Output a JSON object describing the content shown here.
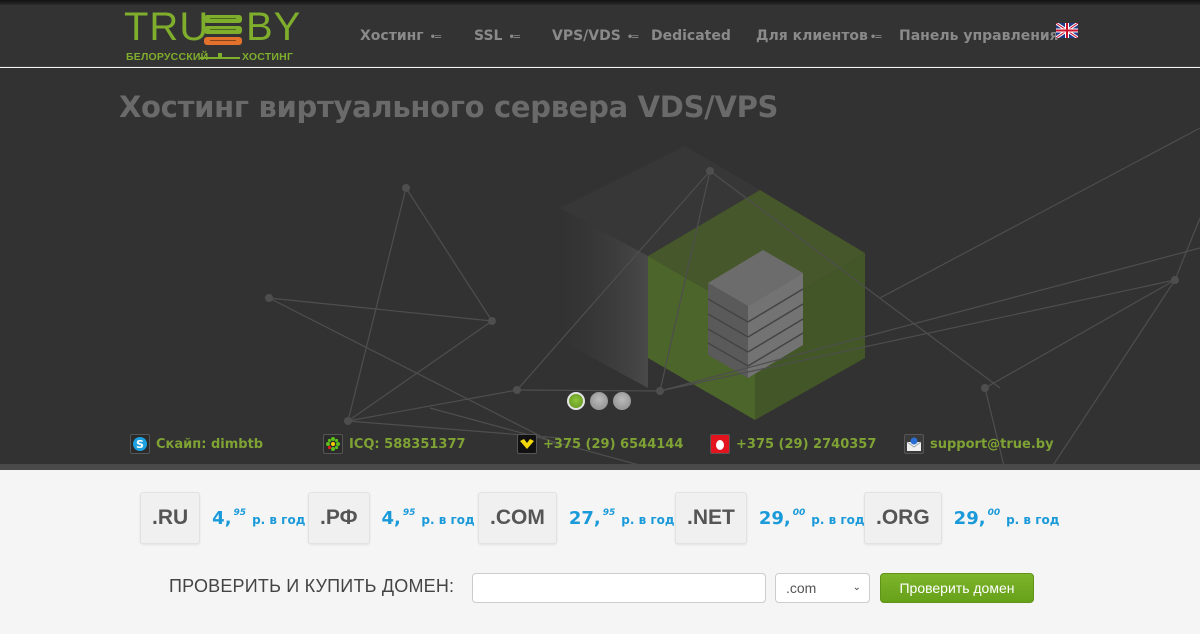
{
  "logo": {
    "left": "TRU",
    "right": "BY",
    "tagline_left": "БЕЛОРУССКИЙ",
    "tagline_right": "ХОСТИНГ",
    "colors": {
      "green": "#7fad2c",
      "orange": "#e2712b"
    }
  },
  "nav": {
    "items": [
      {
        "label": "Хостинг",
        "dropdown": true
      },
      {
        "label": "SSL",
        "dropdown": true
      },
      {
        "label": "VPS/VDS",
        "dropdown": true
      },
      {
        "label": "Dedicated",
        "dropdown": false
      },
      {
        "label": "Для клиентов",
        "dropdown": true
      },
      {
        "label": "Панель управления",
        "dropdown": false
      }
    ],
    "dropdown_glyph": "•═",
    "language_flag": "uk-flag-icon"
  },
  "hero": {
    "title": "Хостинг виртуального сервера VDS/VPS",
    "slider": {
      "slides": 3,
      "active_index": 0
    }
  },
  "contacts": [
    {
      "icon": "skype-icon",
      "text": "Скайп: dimbtb"
    },
    {
      "icon": "icq-icon",
      "text": "ICQ: 588351377"
    },
    {
      "icon": "velcom-icon",
      "text": "+375 (29) 6544144"
    },
    {
      "icon": "mts-icon",
      "text": "+375 (29) 2740357"
    },
    {
      "icon": "mail-icon",
      "text": "support@true.by"
    }
  ],
  "domains": [
    {
      "zone": ".RU",
      "price_int": "4,",
      "price_frac": "95",
      "period": "р. в год"
    },
    {
      "zone": ".РФ",
      "price_int": "4,",
      "price_frac": "95",
      "period": "р. в год"
    },
    {
      "zone": ".COM",
      "price_int": "27,",
      "price_frac": "95",
      "period": "р. в год"
    },
    {
      "zone": ".NET",
      "price_int": "29,",
      "price_frac": "00",
      "period": "р. в год"
    },
    {
      "zone": ".ORG",
      "price_int": "29,",
      "price_frac": "00",
      "period": "р. в год"
    }
  ],
  "domain_check": {
    "label": "ПРОВЕРИТЬ И КУПИТЬ ДОМЕН:",
    "input_value": "",
    "input_placeholder": "",
    "selected_zone": ".com",
    "button_label": "Проверить домен"
  },
  "colors": {
    "accent_green": "#7fad2c",
    "price_blue": "#1a9ad9",
    "contact_green": "#7fa234",
    "header_bg": "#333333"
  }
}
